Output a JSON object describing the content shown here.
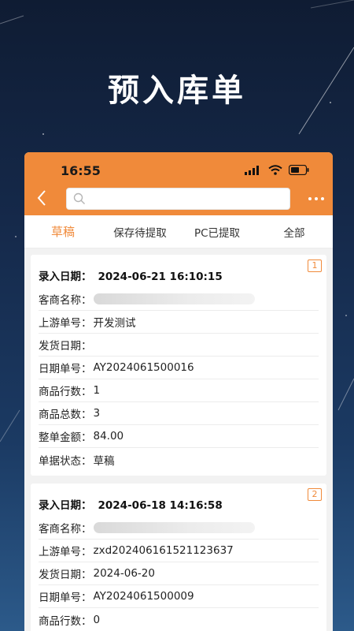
{
  "hero": {
    "title": "预入库单"
  },
  "status_bar": {
    "time": "16:55"
  },
  "nav": {
    "back_icon": "chevron-left-icon",
    "search": {
      "placeholder": ""
    },
    "more_icon": "ellipsis-icon"
  },
  "tabs": [
    {
      "label": "草稿",
      "active": true
    },
    {
      "label": "保存待提取",
      "active": false
    },
    {
      "label": "PC已提取",
      "active": false
    },
    {
      "label": "全部",
      "active": false
    }
  ],
  "colors": {
    "accent": "#f08a3a",
    "background_top": "#0f1c33",
    "background_bottom": "#2c5a8a"
  },
  "cards": [
    {
      "badge": "1",
      "entry_date_label": "录入日期：",
      "entry_date": "2024-06-21 16:10:15",
      "fields": [
        {
          "label": "客商名称：",
          "value": "",
          "redacted": true
        },
        {
          "label": "上游单号：",
          "value": "开发测试"
        },
        {
          "label": "发货日期：",
          "value": ""
        },
        {
          "label": "日期单号：",
          "value": "AY2024061500016"
        },
        {
          "label": "商品行数：",
          "value": "1"
        },
        {
          "label": "商品总数：",
          "value": "3"
        },
        {
          "label": "整单金额：",
          "value": "84.00"
        },
        {
          "label": "单据状态：",
          "value": "草稿"
        }
      ]
    },
    {
      "badge": "2",
      "entry_date_label": "录入日期：",
      "entry_date": "2024-06-18 14:16:58",
      "fields": [
        {
          "label": "客商名称：",
          "value": "",
          "redacted": true
        },
        {
          "label": "上游单号：",
          "value": "zxd20240616152112363​7"
        },
        {
          "label": "发货日期：",
          "value": "2024-06-20"
        },
        {
          "label": "日期单号：",
          "value": "AY2024061500009"
        },
        {
          "label": "商品行数：",
          "value": "0"
        }
      ]
    }
  ]
}
